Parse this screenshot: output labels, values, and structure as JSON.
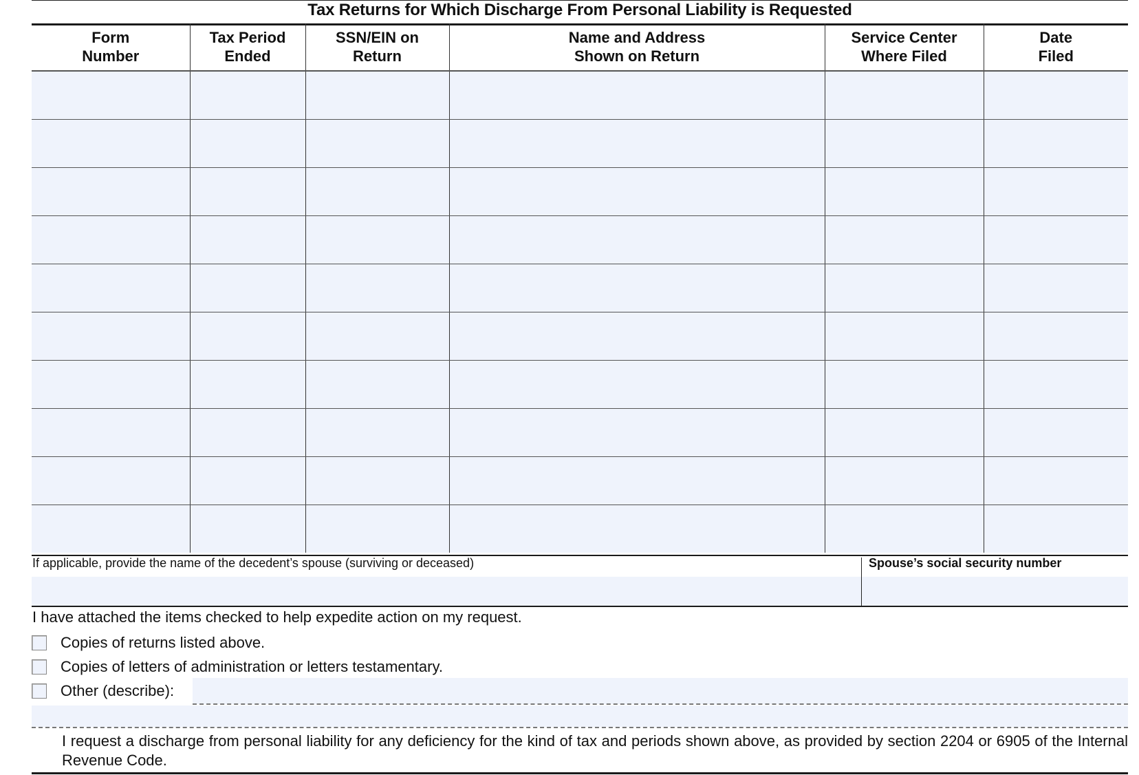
{
  "title": "Tax Returns for Which Discharge From Personal Liability is Requested",
  "table": {
    "columns": [
      {
        "line1": "Form",
        "line2": "Number"
      },
      {
        "line1": "Tax Period",
        "line2": "Ended"
      },
      {
        "line1": "SSN/EIN on",
        "line2": "Return"
      },
      {
        "line1": "Name and Address",
        "line2": "Shown on Return"
      },
      {
        "line1": "Service Center",
        "line2": "Where Filed"
      },
      {
        "line1": "Date",
        "line2": "Filed"
      }
    ],
    "row_count": 10,
    "rows": [
      [
        "",
        "",
        "",
        "",
        "",
        ""
      ],
      [
        "",
        "",
        "",
        "",
        "",
        ""
      ],
      [
        "",
        "",
        "",
        "",
        "",
        ""
      ],
      [
        "",
        "",
        "",
        "",
        "",
        ""
      ],
      [
        "",
        "",
        "",
        "",
        "",
        ""
      ],
      [
        "",
        "",
        "",
        "",
        "",
        ""
      ],
      [
        "",
        "",
        "",
        "",
        "",
        ""
      ],
      [
        "",
        "",
        "",
        "",
        "",
        ""
      ],
      [
        "",
        "",
        "",
        "",
        "",
        ""
      ],
      [
        "",
        "",
        "",
        "",
        "",
        ""
      ]
    ]
  },
  "spouse": {
    "name_label": "If applicable, provide the name of the decedent’s spouse (surviving or deceased)",
    "name_value": "",
    "ssn_label": "Spouse’s social security number",
    "ssn_value": ""
  },
  "attachments": {
    "intro": "I have attached the items checked to help expedite action on my request.",
    "items": [
      {
        "label": "Copies of returns listed above.",
        "checked": false
      },
      {
        "label": "Copies of letters of administration or letters testamentary.",
        "checked": false
      },
      {
        "label": "Other (describe):",
        "checked": false
      }
    ],
    "other_value": ""
  },
  "request_statement": "I request a discharge from personal liability for any deficiency for the kind of tax and periods shown above, as provided by section 2204 or 6905 of the Internal Revenue Code."
}
